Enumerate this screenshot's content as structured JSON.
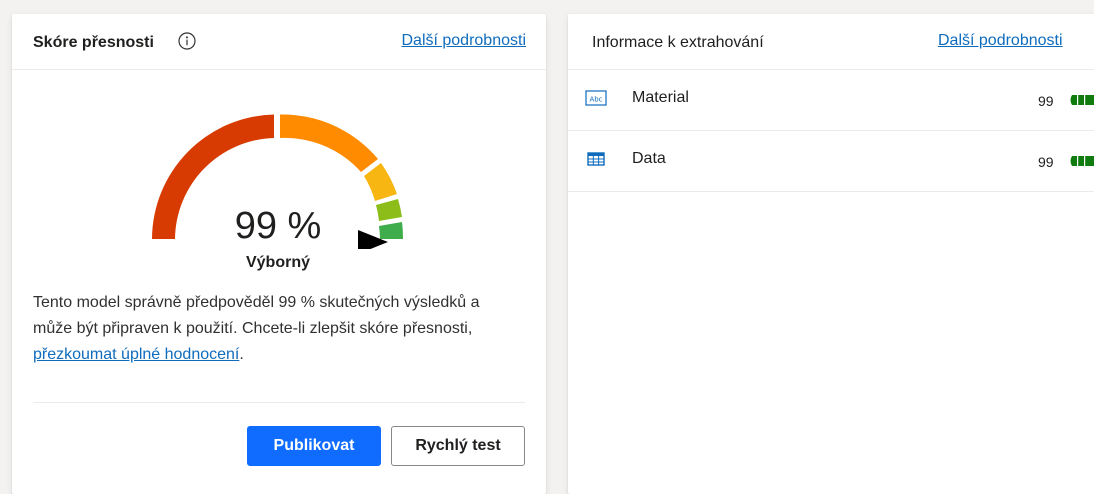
{
  "score_card": {
    "title": "Skóre přesnosti",
    "details_link": "Další podrobnosti",
    "gauge": {
      "value_text": "99 %",
      "value": 99,
      "rating": "Výborný",
      "segment_colors": [
        "#d83b01",
        "#ff8c00",
        "#f7b611",
        "#8cbd18",
        "#3fad4b"
      ],
      "pointer_color": "#000000"
    },
    "description_prefix": "Tento model správně předpověděl 99 % skutečných výsledků a může být připraven k použití. Chcete-li zlepšit skóre přesnosti, ",
    "description_link": "přezkoumat úplné hodnocení",
    "description_suffix": ".",
    "publish_button": "Publikovat",
    "quick_test_button": "Rychlý test"
  },
  "extract_card": {
    "title": "Informace k extrahování",
    "details_link": "Další podrobnosti",
    "fields": [
      {
        "name": "Material",
        "score": "99",
        "icon": "text-field-icon"
      },
      {
        "name": "Data",
        "score": "99",
        "icon": "table-icon"
      }
    ],
    "bar_color": "#107c10"
  }
}
